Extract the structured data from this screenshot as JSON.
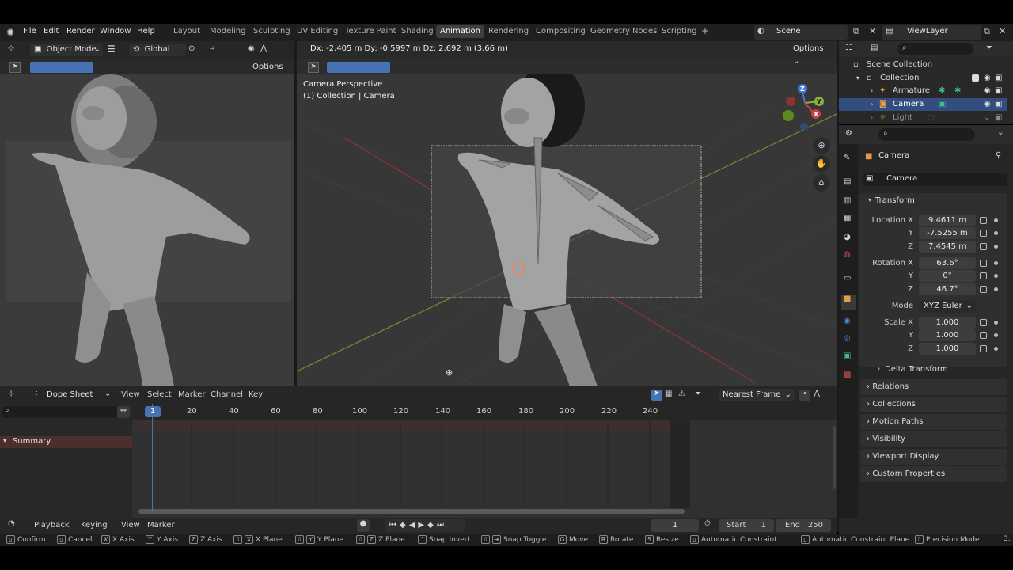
{
  "menubar": {
    "items": [
      "File",
      "Edit",
      "Render",
      "Window",
      "Help"
    ],
    "workspaces": [
      "Layout",
      "Modeling",
      "Sculpting",
      "UV Editing",
      "Texture Paint",
      "Shading",
      "Animation",
      "Rendering",
      "Compositing",
      "Geometry Nodes",
      "Scripting"
    ],
    "active_workspace": "Animation",
    "add_tab": "+",
    "scene_label": "Scene",
    "viewlayer_label": "ViewLayer"
  },
  "left_viewport": {
    "mode": "Object Mode",
    "orientation": "Global",
    "options": "Options"
  },
  "main_viewport": {
    "transform_readout": "Dx: -2.405 m   Dy: -0.5997 m   Dz: 2.692 m (3.66 m)",
    "options": "Options",
    "overlay_title": "Camera Perspective",
    "overlay_subtitle": "(1) Collection | Camera",
    "gizmo_x": "X",
    "gizmo_y": "Y",
    "gizmo_z": "Z"
  },
  "outliner": {
    "rows": [
      {
        "label": "Scene Collection",
        "selected": false
      },
      {
        "label": "Collection",
        "selected": false
      },
      {
        "label": "Armature",
        "selected": false
      },
      {
        "label": "Camera",
        "selected": true
      },
      {
        "label": "Light",
        "selected": false
      }
    ]
  },
  "properties": {
    "object_name": "Camera",
    "data_name": "Camera",
    "transform_header": "Transform",
    "location_label": "Location X",
    "location": [
      "9.4611 m",
      "-7.5255 m",
      "7.4545 m"
    ],
    "rotation_label": "Rotation X",
    "rotation": [
      "63.6°",
      "0°",
      "46.7°"
    ],
    "mode_label": "Mode",
    "mode_value": "XYZ Euler",
    "scale_label": "Scale X",
    "scale": [
      "1.000",
      "1.000",
      "1.000"
    ],
    "axis_y": "Y",
    "axis_z": "Z",
    "delta_transform": "Delta Transform",
    "panels": [
      "Relations",
      "Collections",
      "Motion Paths",
      "Visibility",
      "Viewport Display",
      "Custom Properties"
    ]
  },
  "dopesheet": {
    "editor": "Dope Sheet",
    "menus": [
      "View",
      "Select",
      "Marker",
      "Channel",
      "Key"
    ],
    "snap": "Nearest Frame",
    "summary": "Summary",
    "current_frame_badge": "1",
    "ticks": [
      "20",
      "40",
      "60",
      "80",
      "100",
      "120",
      "140",
      "160",
      "180",
      "200",
      "220",
      "240"
    ]
  },
  "timeline": {
    "menus": [
      "Playback",
      "Keying",
      "View",
      "Marker"
    ],
    "current_frame": "1",
    "start_label": "Start",
    "start": "1",
    "end_label": "End",
    "end": "250"
  },
  "statusbar": {
    "items": [
      {
        "key": "",
        "label": "Confirm"
      },
      {
        "key": "",
        "label": "Cancel"
      },
      {
        "key": "X",
        "label": "X Axis"
      },
      {
        "key": "Y",
        "label": "Y Axis"
      },
      {
        "key": "Z",
        "label": "Z Axis"
      },
      {
        "key": "X",
        "label": "X Plane"
      },
      {
        "key": "Y",
        "label": "Y Plane"
      },
      {
        "key": "Z",
        "label": "Z Plane"
      },
      {
        "key": "",
        "label": "Snap Invert"
      },
      {
        "key": "",
        "label": "Snap Toggle"
      },
      {
        "key": "G",
        "label": "Move"
      },
      {
        "key": "R",
        "label": "Rotate"
      },
      {
        "key": "S",
        "label": "Resize"
      },
      {
        "key": "",
        "label": "Automatic Constraint"
      },
      {
        "key": "",
        "label": "Automatic Constraint Plane"
      },
      {
        "key": "",
        "label": "Precision Mode"
      }
    ],
    "version": "3."
  },
  "colors": {
    "accent": "#4772b3",
    "x_axis": "#c9413f",
    "y_axis": "#8fae3a",
    "z_axis": "#3d79d6",
    "selection": "#334d80"
  }
}
